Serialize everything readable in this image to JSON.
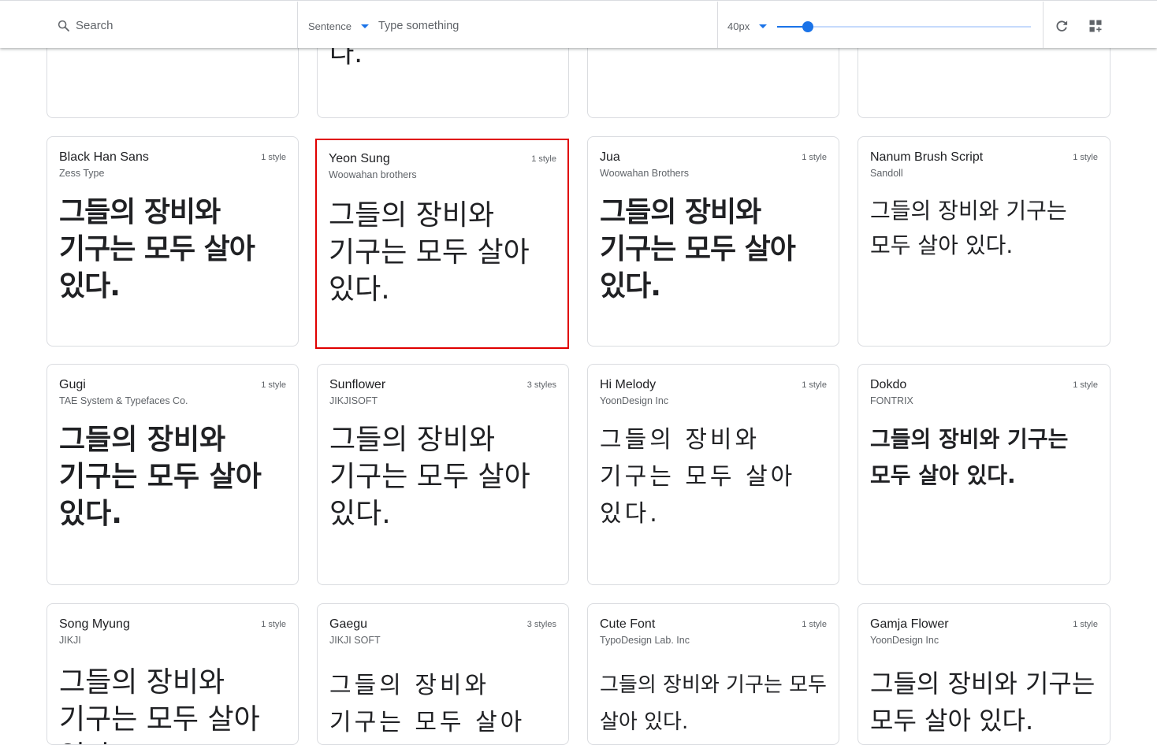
{
  "toolbar": {
    "search_label": "Search",
    "sentence_mode": "Sentence",
    "type_placeholder": "Type something",
    "font_size": "40px",
    "slider_value_fraction": 0.12
  },
  "top_row_partial": [
    {
      "sample": ""
    },
    {
      "sample": "다."
    },
    {
      "sample": ""
    },
    {
      "sample": ""
    }
  ],
  "fonts": [
    {
      "name": "Black Han Sans",
      "author": "Zess Type",
      "styles": "1 style",
      "sample": "그들의 장비와 기구는 모두 살아 있다."
    },
    {
      "name": "Yeon Sung",
      "author": "Woowahan brothers",
      "styles": "1 style",
      "sample": "그들의 장비와 기구는 모두 살아 있다."
    },
    {
      "name": "Jua",
      "author": "Woowahan Brothers",
      "styles": "1 style",
      "sample": "그들의 장비와 기구는 모두 살아 있다."
    },
    {
      "name": "Nanum Brush Script",
      "author": "Sandoll",
      "styles": "1 style",
      "sample": "그들의 장비와 기구는 모두 살아 있다."
    },
    {
      "name": "Gugi",
      "author": "TAE System & Typefaces Co.",
      "styles": "1 style",
      "sample": "그들의 장비와 기구는 모두 살아 있다."
    },
    {
      "name": "Sunflower",
      "author": "JIKJISOFT",
      "styles": "3 styles",
      "sample": "그들의 장비와 기구는 모두 살아 있다."
    },
    {
      "name": "Hi Melody",
      "author": "YoonDesign Inc",
      "styles": "1 style",
      "sample": "그들의 장비와 기구는 모두 살아 있다."
    },
    {
      "name": "Dokdo",
      "author": "FONTRIX",
      "styles": "1 style",
      "sample": "그들의 장비와 기구는 모두 살아 있다."
    },
    {
      "name": "Song Myung",
      "author": "JIKJI",
      "styles": "1 style",
      "sample": "그들의 장비와 기구는 모두 살아 있다."
    },
    {
      "name": "Gaegu",
      "author": "JIKJI SOFT",
      "styles": "3 styles",
      "sample": "그들의 장비와 기구는 모두 살아 있다."
    },
    {
      "name": "Cute Font",
      "author": "TypoDesign Lab. Inc",
      "styles": "1 style",
      "sample": "그들의 장비와 기구는 모두 살아 있다."
    },
    {
      "name": "Gamja Flower",
      "author": "YoonDesign Inc",
      "styles": "1 style",
      "sample": "그들의 장비와 기구는 모두 살아 있다."
    }
  ],
  "colors": {
    "accent": "#1a73e8",
    "selection_outline": "#e00000",
    "card_border": "#dadce0"
  }
}
